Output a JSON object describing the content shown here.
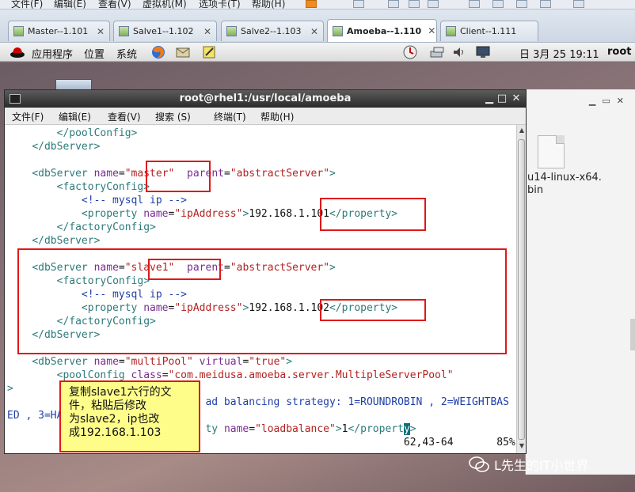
{
  "host_menu": {
    "items": [
      "文件(F)",
      "编辑(E)",
      "查看(V)",
      "虚拟机(M)",
      "选项卡(T)",
      "帮助(H)"
    ]
  },
  "vm_tabs": [
    {
      "label": "Master--1.101",
      "active": false
    },
    {
      "label": "Salve1--1.102",
      "active": false
    },
    {
      "label": "Salve2--1.103",
      "active": false
    },
    {
      "label": "Amoeba--1.110",
      "active": true
    },
    {
      "label": "Client--1.111",
      "active": false
    }
  ],
  "gnome_panel": {
    "applications": "应用程序",
    "places": "位置",
    "system": "系统",
    "datetime": "日 3月 25 19:11",
    "user": "root"
  },
  "desktop": {
    "file_name": "u14-linux-x64.\nbin"
  },
  "terminal": {
    "title": "root@rhel1:/usr/local/amoeba",
    "menu": [
      "文件(F)",
      "编辑(E)",
      "查看(V)",
      "搜索 (S)",
      "终端(T)",
      "帮助(H)"
    ],
    "lines": [
      [
        {
          "t": "        ",
          "c": "c-txt"
        },
        {
          "t": "</poolConfig>",
          "c": "c-tag"
        }
      ],
      [
        {
          "t": "    ",
          "c": "c-txt"
        },
        {
          "t": "</dbServer>",
          "c": "c-tag"
        }
      ],
      [
        {
          "t": "",
          "c": "c-txt"
        }
      ],
      [
        {
          "t": "    ",
          "c": "c-txt"
        },
        {
          "t": "<dbServer ",
          "c": "c-tag"
        },
        {
          "t": "name",
          "c": "c-attr"
        },
        {
          "t": "=",
          "c": "c-txt"
        },
        {
          "t": "\"master\"",
          "c": "c-str"
        },
        {
          "t": "  ",
          "c": "c-txt"
        },
        {
          "t": "parent",
          "c": "c-attr"
        },
        {
          "t": "=",
          "c": "c-txt"
        },
        {
          "t": "\"abstractServer\"",
          "c": "c-str"
        },
        {
          "t": ">",
          "c": "c-tag"
        }
      ],
      [
        {
          "t": "        ",
          "c": "c-txt"
        },
        {
          "t": "<factoryConfig>",
          "c": "c-tag"
        }
      ],
      [
        {
          "t": "            ",
          "c": "c-txt"
        },
        {
          "t": "<!-- mysql ip -->",
          "c": "c-com"
        }
      ],
      [
        {
          "t": "            ",
          "c": "c-txt"
        },
        {
          "t": "<property ",
          "c": "c-tag"
        },
        {
          "t": "name",
          "c": "c-attr"
        },
        {
          "t": "=",
          "c": "c-txt"
        },
        {
          "t": "\"ipAddress\"",
          "c": "c-str"
        },
        {
          "t": ">",
          "c": "c-tag"
        },
        {
          "t": "192.168.1.101",
          "c": "c-txt"
        },
        {
          "t": "</property>",
          "c": "c-tag"
        }
      ],
      [
        {
          "t": "        ",
          "c": "c-txt"
        },
        {
          "t": "</factoryConfig>",
          "c": "c-tag"
        }
      ],
      [
        {
          "t": "    ",
          "c": "c-txt"
        },
        {
          "t": "</dbServer>",
          "c": "c-tag"
        }
      ],
      [
        {
          "t": "",
          "c": "c-txt"
        }
      ],
      [
        {
          "t": "    ",
          "c": "c-txt"
        },
        {
          "t": "<dbServer ",
          "c": "c-tag"
        },
        {
          "t": "name",
          "c": "c-attr"
        },
        {
          "t": "=",
          "c": "c-txt"
        },
        {
          "t": "\"slave1\"",
          "c": "c-str"
        },
        {
          "t": "  ",
          "c": "c-txt"
        },
        {
          "t": "parent",
          "c": "c-attr"
        },
        {
          "t": "=",
          "c": "c-txt"
        },
        {
          "t": "\"abstractServer\"",
          "c": "c-str"
        },
        {
          "t": ">",
          "c": "c-tag"
        }
      ],
      [
        {
          "t": "        ",
          "c": "c-txt"
        },
        {
          "t": "<factoryConfig>",
          "c": "c-tag"
        }
      ],
      [
        {
          "t": "            ",
          "c": "c-txt"
        },
        {
          "t": "<!-- mysql ip -->",
          "c": "c-com"
        }
      ],
      [
        {
          "t": "            ",
          "c": "c-txt"
        },
        {
          "t": "<property ",
          "c": "c-tag"
        },
        {
          "t": "name",
          "c": "c-attr"
        },
        {
          "t": "=",
          "c": "c-txt"
        },
        {
          "t": "\"ipAddress\"",
          "c": "c-str"
        },
        {
          "t": ">",
          "c": "c-tag"
        },
        {
          "t": "192.168.1.102",
          "c": "c-txt"
        },
        {
          "t": "</property>",
          "c": "c-tag"
        }
      ],
      [
        {
          "t": "        ",
          "c": "c-txt"
        },
        {
          "t": "</factoryConfig>",
          "c": "c-tag"
        }
      ],
      [
        {
          "t": "    ",
          "c": "c-txt"
        },
        {
          "t": "</dbServer>",
          "c": "c-tag"
        }
      ],
      [
        {
          "t": "",
          "c": "c-txt"
        }
      ],
      [
        {
          "t": "    ",
          "c": "c-txt"
        },
        {
          "t": "<dbServer ",
          "c": "c-tag"
        },
        {
          "t": "name",
          "c": "c-attr"
        },
        {
          "t": "=",
          "c": "c-txt"
        },
        {
          "t": "\"multiPool\"",
          "c": "c-str"
        },
        {
          "t": " ",
          "c": "c-txt"
        },
        {
          "t": "virtual",
          "c": "c-attr"
        },
        {
          "t": "=",
          "c": "c-txt"
        },
        {
          "t": "\"true\"",
          "c": "c-str"
        },
        {
          "t": ">",
          "c": "c-tag"
        }
      ],
      [
        {
          "t": "        ",
          "c": "c-txt"
        },
        {
          "t": "<poolConfig ",
          "c": "c-tag"
        },
        {
          "t": "class",
          "c": "c-attr"
        },
        {
          "t": "=",
          "c": "c-txt"
        },
        {
          "t": "\"com.meidusa.amoeba.server.MultipleServerPool\"",
          "c": "c-str"
        }
      ],
      [
        {
          "t": ">",
          "c": "c-tag"
        }
      ],
      [
        {
          "t": "                                ",
          "c": "c-txt"
        },
        {
          "t": "ad balancing strategy: 1=ROUNDROBIN , 2=WEIGHTBAS",
          "c": "c-com"
        }
      ],
      [
        {
          "t": "ED , 3=HA",
          "c": "c-com"
        }
      ],
      [
        {
          "t": "                                ",
          "c": "c-txt"
        },
        {
          "t": "ty ",
          "c": "c-tag"
        },
        {
          "t": "name",
          "c": "c-attr"
        },
        {
          "t": "=",
          "c": "c-txt"
        },
        {
          "t": "\"loadbalance\"",
          "c": "c-str"
        },
        {
          "t": ">",
          "c": "c-tag"
        },
        {
          "t": "1",
          "c": "c-txt"
        },
        {
          "t": "</propert",
          "c": "c-tag"
        },
        {
          "t": "y",
          "c": "c-cur"
        },
        {
          "t": ">",
          "c": "c-tag"
        }
      ],
      [
        {
          "t": "                                                                62,43-64       85%",
          "c": "c-status"
        }
      ]
    ]
  },
  "note": {
    "lines": [
      "复制slave1六行的文",
      "件，粘贴后修改",
      "为slave2，ip也改",
      "成192.168.1.103"
    ]
  },
  "watermark": {
    "text": "L先生的IT小世界"
  },
  "colors": {
    "annotation_red": "#e01818",
    "note_bg": "#fffd8a",
    "terminal_title": "#2b2b2b"
  }
}
